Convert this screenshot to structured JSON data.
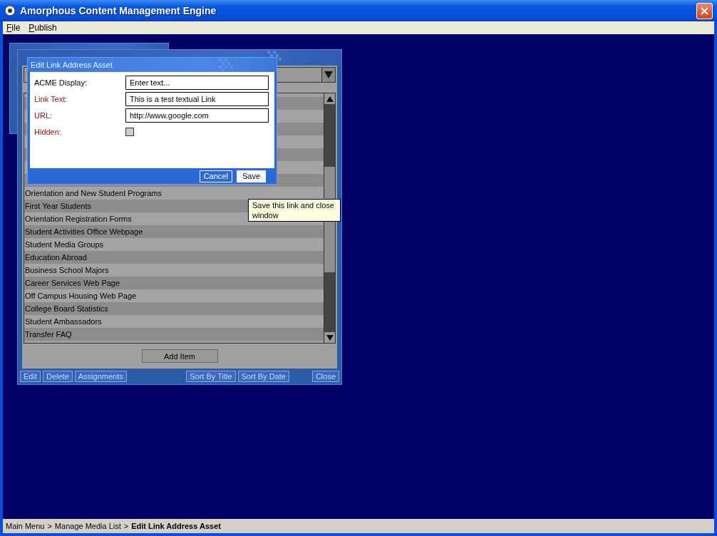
{
  "window": {
    "title": "Amorphous Content Management Engine"
  },
  "menu": [
    {
      "label": "File"
    },
    {
      "label": "Publish"
    }
  ],
  "media_list": {
    "list_items": [
      "Orientation and New Student Programs",
      "First Year Students",
      "Orientation Registration Forms",
      "Student Activities Office Webpage",
      "Student Media Groups",
      "Education Abroad",
      "Business School Majors",
      "Career Services Web Page",
      "Off Campus Housing Web Page",
      "College Board Statistics",
      "Student Ambassadors",
      "Transfer FAQ"
    ],
    "add_button": "Add Item",
    "left_buttons": [
      "Edit",
      "Delete",
      "Assignments"
    ],
    "right_buttons": [
      "Sort By Title",
      "Sort By Date"
    ],
    "close_button": "Close"
  },
  "dialog": {
    "title": "Edit Link Address Asset",
    "fields": [
      {
        "kind": "text",
        "label": "ACME Display:",
        "required": false,
        "placeholder": "Enter text..."
      },
      {
        "kind": "text",
        "label": "Link Text:",
        "required": true,
        "value": "This is a test textual Link"
      },
      {
        "kind": "text",
        "label": "URL:",
        "required": true,
        "value": "http://www.google.com"
      },
      {
        "kind": "checkbox",
        "label": "Hidden:",
        "required": true,
        "checked": false
      }
    ],
    "buttons": [
      "Cancel",
      "Save"
    ],
    "tooltip": "Save this link and close window"
  },
  "status_bar": {
    "path": [
      {
        "label": "Main Menu",
        "separator": ">"
      },
      {
        "label": "Manage Media List",
        "separator": ">"
      }
    ],
    "current": "Edit Link Address Asset"
  }
}
